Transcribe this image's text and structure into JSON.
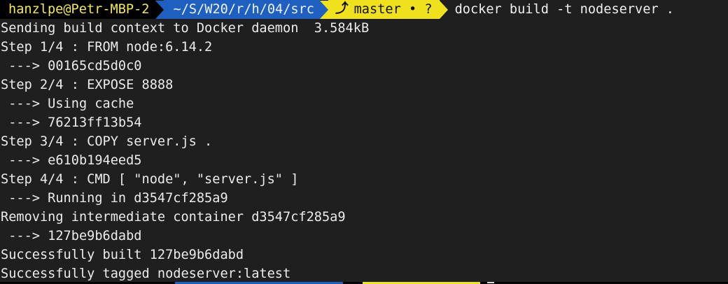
{
  "prompt": {
    "user_host": "hanzlpe@Petr-MBP-2",
    "path": "~/S/W20/r/h/04/src",
    "git_icon": "⤴",
    "git_branch": "master • ?",
    "command": "docker build -t nodeserver ."
  },
  "output": {
    "lines": [
      "Sending build context to Docker daemon  3.584kB",
      "Step 1/4 : FROM node:6.14.2",
      " ---> 00165cd5d0c0",
      "Step 2/4 : EXPOSE 8888",
      " ---> Using cache",
      " ---> 76213ff13b54",
      "Step 3/4 : COPY server.js .",
      " ---> e610b194eed5",
      "Step 4/4 : CMD [ \"node\", \"server.js\" ]",
      " ---> Running in d3547cf285a9",
      "Removing intermediate container d3547cf285a9",
      " ---> 127be9b6dabd",
      "Successfully built 127be9b6dabd",
      "Successfully tagged nodeserver:latest"
    ]
  },
  "colors": {
    "background": "#1f1f1f",
    "user_segment_bg": "#000000",
    "user_segment_fg": "#f2e85a",
    "path_segment_bg": "#1f5fbf",
    "git_segment_bg": "#f0e11f",
    "text": "#ececec"
  }
}
